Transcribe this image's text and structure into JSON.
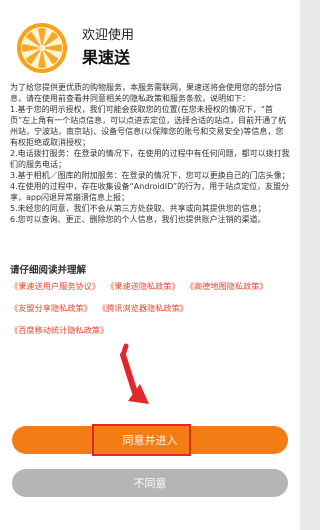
{
  "header": {
    "welcome": "欢迎使用",
    "app_name": "果速送"
  },
  "body": {
    "paragraphs": [
      "为了给您提供更优质的购物服务，本服务需联网，果速送将会使用您的部分信息，请在使用前查看并同意相关的隐私政策和服务条款，说明如下：",
      "1.基于您的明示授权，我们可能会获取您的位置(在您未授权的情况下，“首页”左上角有一个站点信息，可以点进去定位，选择合适的站点，目前开通了杭州站，宁波站，南京站)、设备号信息(以保障您的账号和交易安全)等信息，您有权拒绝或取消授权；",
      "2.电话拨打服务：在登录的情况下，在使用的过程中有任何问题，都可以拨打我们的服务电话；",
      "3.基于相机／图库的附加服务：在登录的情况下，您可以更换自己的门店头像；",
      "4.在使用的过程中，存在收集设备“AndroidID”的行为，用于站点定位，友盟分享，app闪退异常崩溃信息上报；",
      "5.未经您的同意，我们不会从第三方处获取、共享或向其提供您的信息；",
      "6.您可以查询、更正、删除您的个人信息，我们也提供账户注销的渠道。"
    ]
  },
  "read_prompt": "请仔细阅读并理解",
  "policy_links": [
    "《果速送用户服务协议》",
    "《果速送隐私政策》",
    "《高德地图隐私政策》",
    "《友盟分享隐私政策》",
    "《腾讯浏览器隐私政策》",
    "《百度移动统计隐私政策》"
  ],
  "buttons": {
    "agree": "同意并进入",
    "disagree": "不同意"
  },
  "colors": {
    "accent": "#f47c15",
    "link": "#e8472f",
    "annotation": "#e3262a"
  },
  "icons": {
    "logo": "orange-slice-logo-icon"
  }
}
